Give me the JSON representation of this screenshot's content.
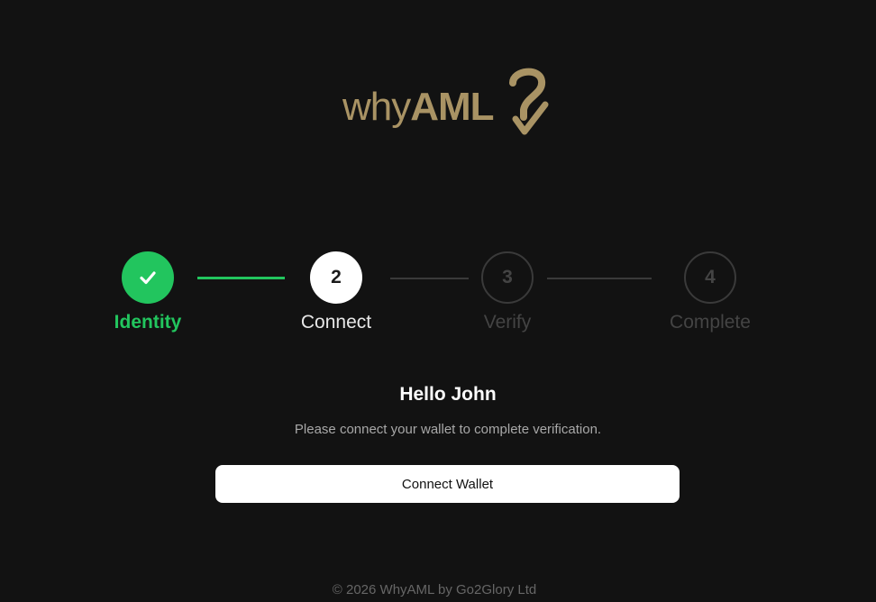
{
  "brand": {
    "logo_light": "why",
    "logo_bold": "AML",
    "accent_color": "#a99364"
  },
  "stepper": {
    "steps": [
      {
        "number": "1",
        "label": "Identity",
        "state": "done"
      },
      {
        "number": "2",
        "label": "Connect",
        "state": "active"
      },
      {
        "number": "3",
        "label": "Verify",
        "state": "pending"
      },
      {
        "number": "4",
        "label": "Complete",
        "state": "pending"
      }
    ],
    "done_color": "#22c55e"
  },
  "content": {
    "greeting": "Hello John",
    "subtitle": "Please connect your wallet to complete verification.",
    "button_label": "Connect Wallet"
  },
  "footer": {
    "text": "© 2026 WhyAML by Go2Glory Ltd"
  }
}
